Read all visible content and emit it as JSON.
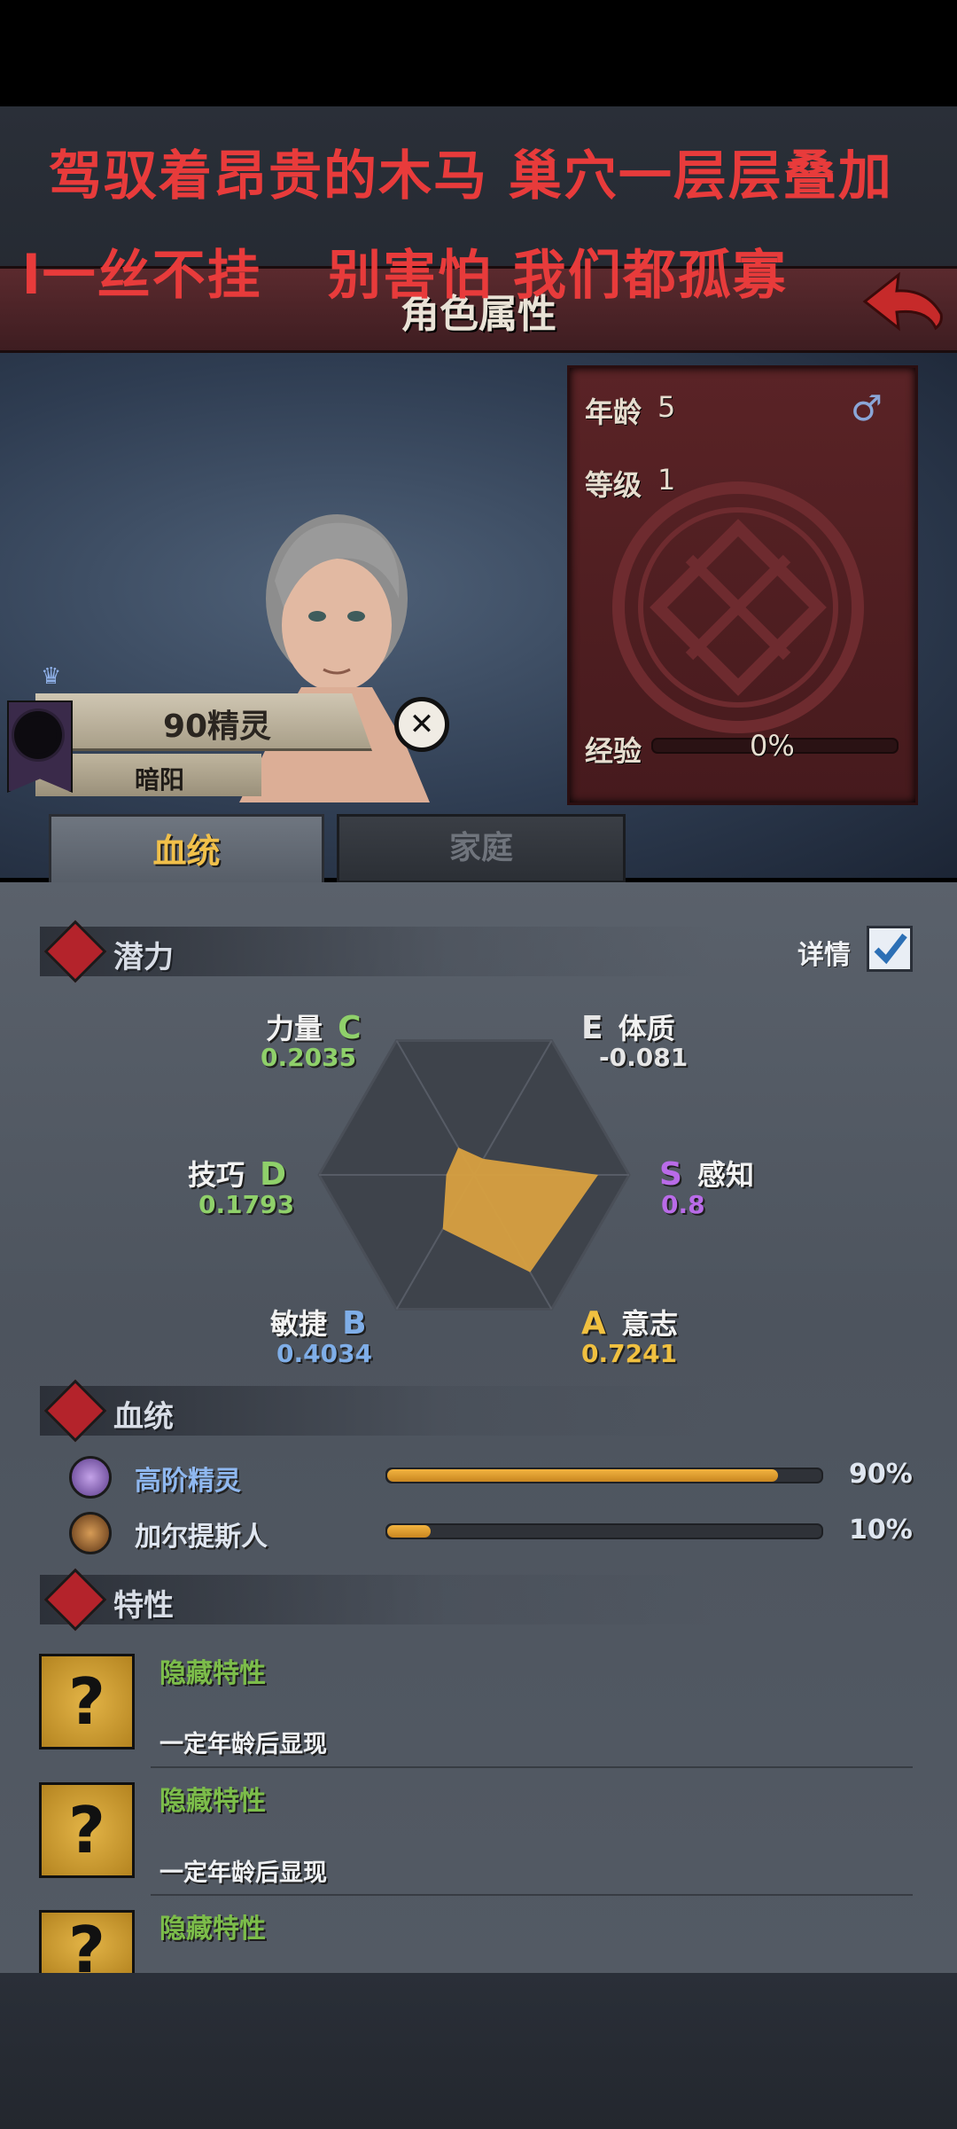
{
  "overlay": {
    "line1": "驾驭着昂贵的木马 巢穴一层层叠加",
    "line2a": "l一丝不挂",
    "line2b": "别害怕 我们都孤寡"
  },
  "header": {
    "title": "角色属性"
  },
  "info": {
    "age_label": "年龄",
    "age_value": "5",
    "level_label": "等级",
    "level_value": "1",
    "exp_label": "经验",
    "exp_value": "0%",
    "gender_symbol": "♂"
  },
  "character": {
    "race": "90精灵",
    "title": "暗阳"
  },
  "tabs": {
    "bloodline": "血统",
    "family": "家庭"
  },
  "potential": {
    "title": "潜力",
    "details_label": "详情",
    "details_checked": true,
    "stats": [
      {
        "name": "力量",
        "grade": "C",
        "value": "0.2035",
        "color": "#8fd06a"
      },
      {
        "name": "体质",
        "grade": "E",
        "value": "-0.081",
        "color": "#e6e6e6"
      },
      {
        "name": "感知",
        "grade": "S",
        "value": "0.8",
        "color": "#b96be8"
      },
      {
        "name": "意志",
        "grade": "A",
        "value": "0.7241",
        "color": "#f0c040"
      },
      {
        "name": "敏捷",
        "grade": "B",
        "value": "0.4034",
        "color": "#7faee8"
      },
      {
        "name": "技巧",
        "grade": "D",
        "value": "0.1793",
        "color": "#8fd06a"
      }
    ]
  },
  "bloodline": {
    "title": "血统",
    "items": [
      {
        "name": "高阶精灵",
        "percent": "90%",
        "fraction": 0.9,
        "name_color": "#8fb8f0"
      },
      {
        "name": "加尔提斯人",
        "percent": "10%",
        "fraction": 0.1,
        "name_color": "#dfe6f0"
      }
    ]
  },
  "traits": {
    "title": "特性",
    "items": [
      {
        "title": "隐藏特性",
        "desc": "一定年龄后显现"
      },
      {
        "title": "隐藏特性",
        "desc": "一定年龄后显现"
      },
      {
        "title": "隐藏特性",
        "desc": ""
      }
    ],
    "unknown_symbol": "?"
  }
}
